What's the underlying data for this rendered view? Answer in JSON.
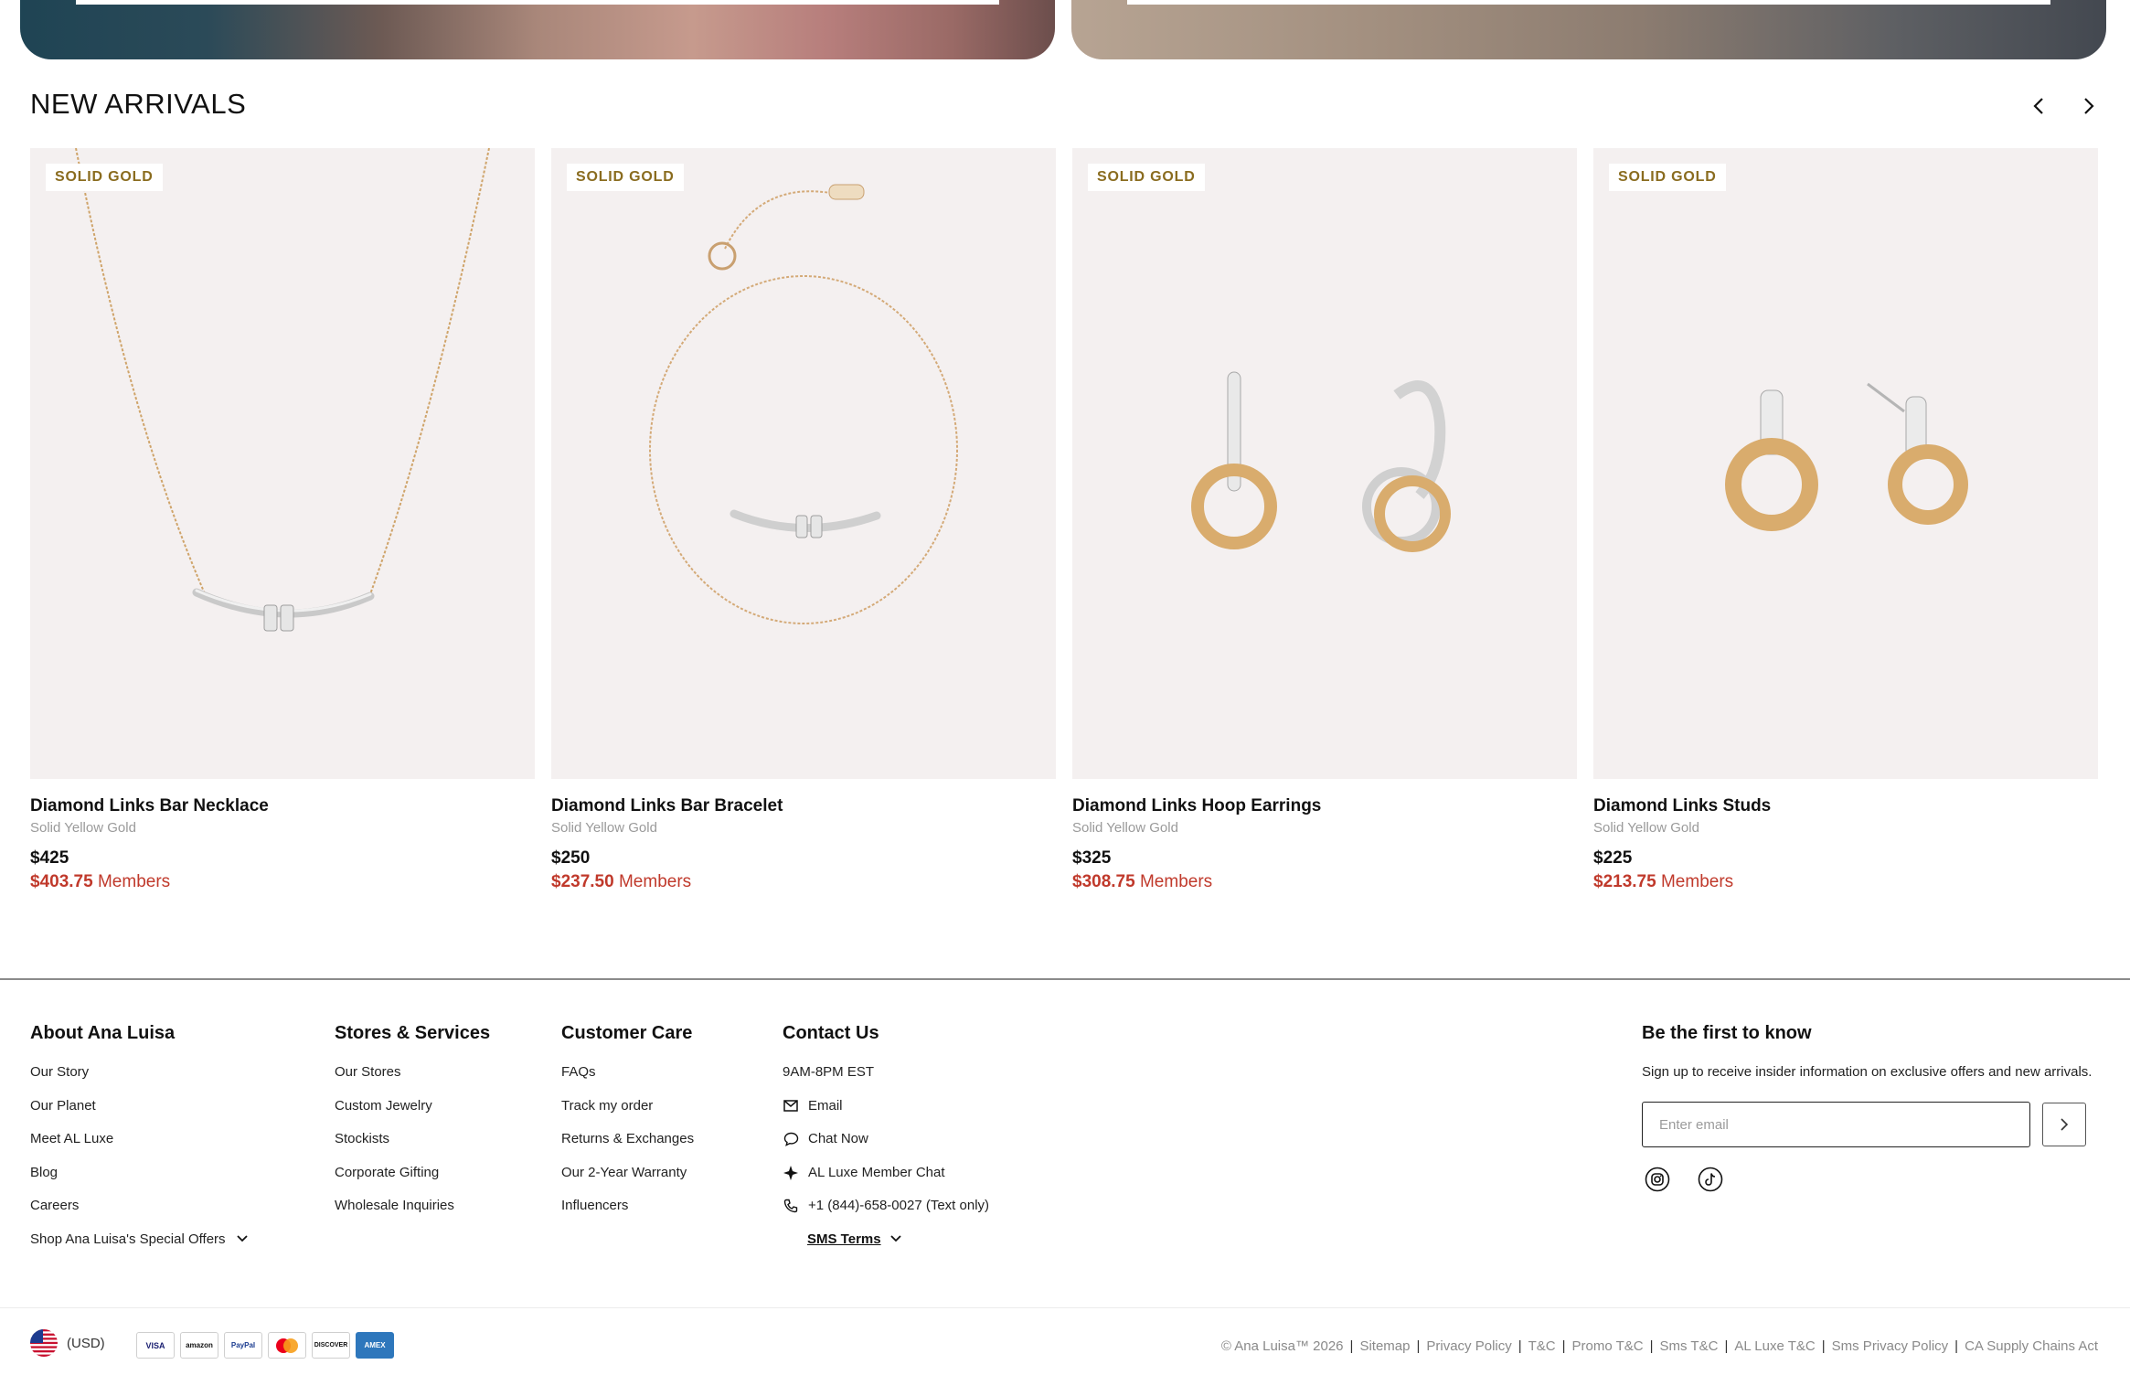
{
  "section": {
    "title": "NEW ARRIVALS"
  },
  "products": [
    {
      "badge": "SOLID GOLD",
      "name": "Diamond Links Bar Necklace",
      "material": "Solid Yellow Gold",
      "price": "$425",
      "member_price": "$403.75",
      "member_label": "Members"
    },
    {
      "badge": "SOLID GOLD",
      "name": "Diamond Links Bar Bracelet",
      "material": "Solid Yellow Gold",
      "price": "$250",
      "member_price": "$237.50",
      "member_label": "Members"
    },
    {
      "badge": "SOLID GOLD",
      "name": "Diamond Links Hoop Earrings",
      "material": "Solid Yellow Gold",
      "price": "$325",
      "member_price": "$308.75",
      "member_label": "Members"
    },
    {
      "badge": "SOLID GOLD",
      "name": "Diamond Links Studs",
      "material": "Solid Yellow Gold",
      "price": "$225",
      "member_price": "$213.75",
      "member_label": "Members"
    }
  ],
  "footer": {
    "about": {
      "title": "About Ana Luisa",
      "items": [
        "Our Story",
        "Our Planet",
        "Meet AL Luxe",
        "Blog",
        "Careers",
        "Shop Ana Luisa's Special Offers"
      ]
    },
    "stores": {
      "title": "Stores & Services",
      "items": [
        "Our Stores",
        "Custom Jewelry",
        "Stockists",
        "Corporate Gifting",
        "Wholesale Inquiries"
      ]
    },
    "care": {
      "title": "Customer Care",
      "items": [
        "FAQs",
        "Track my order",
        "Returns & Exchanges",
        "Our 2-Year Warranty",
        "Influencers"
      ]
    },
    "contact": {
      "title": "Contact Us",
      "hours": "9AM-8PM EST",
      "email": "Email",
      "chat": "Chat Now",
      "luxe_chat": "AL Luxe Member Chat",
      "phone": "+1 (844)-658-0027 (Text only)",
      "sms_terms": "SMS Terms"
    },
    "newsletter": {
      "title": "Be the first to know",
      "text": "Sign up to receive insider information on exclusive offers and new arrivals.",
      "placeholder": "Enter email"
    },
    "currency": "(USD)",
    "payments": [
      "VISA",
      "amazon",
      "PayPal",
      "mastercard",
      "DISCOVER",
      "AMEX"
    ],
    "legal": [
      "© Ana Luisa™ 2026",
      "Sitemap",
      "Privacy Policy",
      "T&C",
      "Promo T&C",
      "Sms T&C",
      "AL Luxe T&C",
      "Sms Privacy Policy",
      "CA Supply Chains Act"
    ]
  },
  "icons": [
    "chevron-left-icon",
    "chevron-right-icon",
    "envelope-icon",
    "chat-bubble-icon",
    "diamond-sparkle-icon",
    "phone-icon",
    "chevron-down-icon",
    "instagram-icon",
    "tiktok-icon",
    "us-flag-icon"
  ],
  "colors": {
    "member_price": "#c0392b",
    "badge_text": "#8a6c1f",
    "card_bg": "#f4f0f0"
  }
}
